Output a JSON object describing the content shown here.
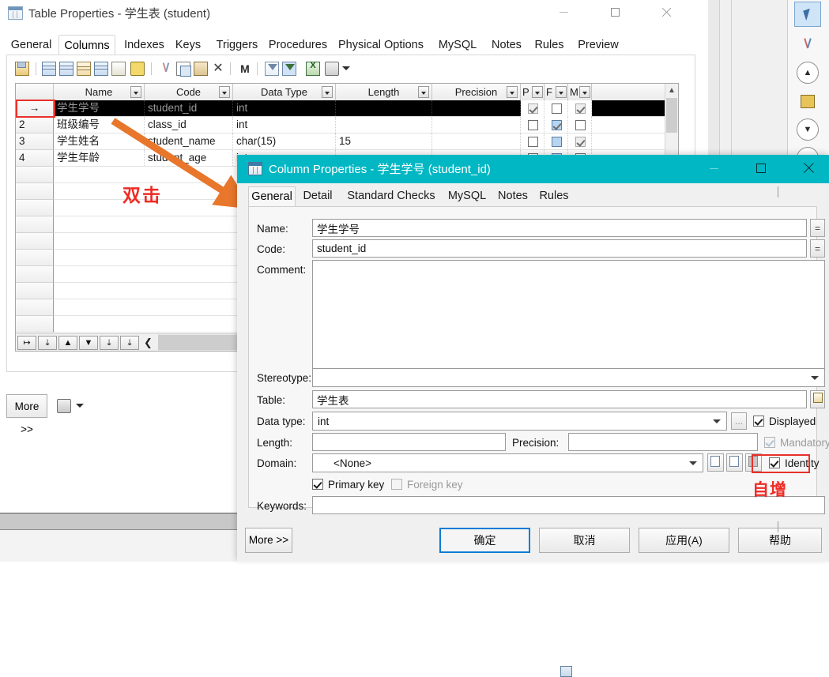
{
  "main_window": {
    "title": "Table Properties - 学生表 (student)",
    "icon": "table-icon",
    "window_controls": {
      "minimize": "minimize-icon",
      "maximize": "maximize-icon",
      "close": "close-icon"
    },
    "tabs": [
      {
        "label": "General",
        "active": false
      },
      {
        "label": "Columns",
        "active": true
      },
      {
        "label": "Indexes",
        "active": false
      },
      {
        "label": "Keys",
        "active": false
      },
      {
        "label": "Triggers",
        "active": false
      },
      {
        "label": "Procedures",
        "active": false
      },
      {
        "label": "Physical Options",
        "active": false
      },
      {
        "label": "MySQL",
        "active": false
      },
      {
        "label": "Notes",
        "active": false
      },
      {
        "label": "Rules",
        "active": false
      },
      {
        "label": "Preview",
        "active": false
      }
    ],
    "toolbar_icons": [
      "properties-icon",
      "insert-row-icon",
      "add-row-icon",
      "add-column-icon",
      "replace-icon",
      "duplicate-icon",
      "key-icon",
      "cut-icon",
      "copy-icon",
      "paste-icon",
      "delete-icon",
      "find-icon",
      "filter-icon",
      "filter-active-icon",
      "export-excel-icon",
      "print-icon",
      "dropdown-caret-icon"
    ],
    "grid": {
      "columns": [
        "Name",
        "Code",
        "Data Type",
        "Length",
        "Precision",
        "P",
        "F",
        "M"
      ],
      "rows": [
        {
          "num": "→",
          "selected": true,
          "name": "学生学号",
          "code": "student_id",
          "datatype": "int",
          "length": "",
          "precision": "",
          "p": "checked-gray",
          "f": "unchecked",
          "m": "checked-gray"
        },
        {
          "num": "2",
          "selected": false,
          "name": "班级编号",
          "code": "class_id",
          "datatype": "int",
          "length": "",
          "precision": "",
          "p": "unchecked",
          "f": "checked-blue",
          "m": "unchecked"
        },
        {
          "num": "3",
          "selected": false,
          "name": "学生姓名",
          "code": "student_name",
          "datatype": "char(15)",
          "length": "15",
          "precision": "",
          "p": "unchecked",
          "f": "blue",
          "m": "checked-gray"
        },
        {
          "num": "4",
          "selected": false,
          "name": "学生年龄",
          "code": "student_age",
          "datatype": "int",
          "length": "",
          "precision": "",
          "p": "unchecked",
          "f": "blue",
          "m": "unchecked"
        }
      ],
      "nav_buttons": [
        "first-icon",
        "prev-page-icon",
        "up-icon",
        "down-icon",
        "next-page-icon",
        "last-icon"
      ],
      "collapse_button": "collapse-left-icon"
    },
    "more_button": "More >>",
    "print_icon": "print-icon",
    "print_caret": "dropdown-caret-icon"
  },
  "annotations": {
    "double_click": "双击",
    "auto_increment": "自增",
    "arrow_color": "#e8762b",
    "highlight_color": "#e8312b"
  },
  "right_sidebar": {
    "items": [
      {
        "icon": "pointer-icon",
        "selected": true
      },
      {
        "icon": "scissors-icon",
        "selected": false
      },
      {
        "icon": "chevron-up-icon",
        "selected": false
      },
      {
        "icon": "lock-icon",
        "selected": false
      },
      {
        "icon": "chevron-down-icon",
        "selected": false
      },
      {
        "icon": "chevron-down-icon",
        "selected": false
      }
    ]
  },
  "dialog": {
    "title": "Column Properties - 学生学号 (student_id)",
    "icon": "column-icon",
    "titlebar_color": "#00b7c3",
    "window_controls": {
      "minimize": "minimize-icon",
      "maximize": "maximize-icon",
      "close": "close-icon"
    },
    "tabs": [
      {
        "label": "General",
        "active": true
      },
      {
        "label": "Detail",
        "active": false
      },
      {
        "label": "Standard Checks",
        "active": false
      },
      {
        "label": "MySQL",
        "active": false
      },
      {
        "label": "Notes",
        "active": false
      },
      {
        "label": "Rules",
        "active": false
      }
    ],
    "fields": {
      "name_label": "Name:",
      "name_value": "学生学号",
      "code_label": "Code:",
      "code_value": "student_id",
      "comment_label": "Comment:",
      "comment_value": "",
      "stereotype_label": "Stereotype:",
      "stereotype_value": "",
      "table_label": "Table:",
      "table_value": "学生表",
      "datatype_label": "Data type:",
      "datatype_value": "int",
      "length_label": "Length:",
      "length_value": "",
      "precision_label": "Precision:",
      "precision_value": "",
      "domain_label": "Domain:",
      "domain_value": "<None>",
      "keywords_label": "Keywords:",
      "keywords_value": ""
    },
    "checkboxes": [
      {
        "label": "Displayed",
        "checked": true,
        "enabled": true,
        "name": "displayed"
      },
      {
        "label": "Mandatory",
        "checked": true,
        "enabled": false,
        "name": "mandatory"
      },
      {
        "label": "Identity",
        "checked": true,
        "enabled": true,
        "name": "identity"
      },
      {
        "label": "Primary key",
        "checked": true,
        "enabled": true,
        "name": "primary-key"
      },
      {
        "label": "Foreign key",
        "checked": false,
        "enabled": false,
        "name": "foreign-key"
      }
    ],
    "buttons": {
      "more": "More >>",
      "ok": "确定",
      "cancel": "取消",
      "apply": "应用(A)",
      "help": "帮助"
    },
    "ellipsis_button": "...",
    "equals_button": "=",
    "domain_tool_icons": [
      "create-icon",
      "properties-icon",
      "delete-icon"
    ],
    "table_browse_icon": "browse-icon"
  }
}
